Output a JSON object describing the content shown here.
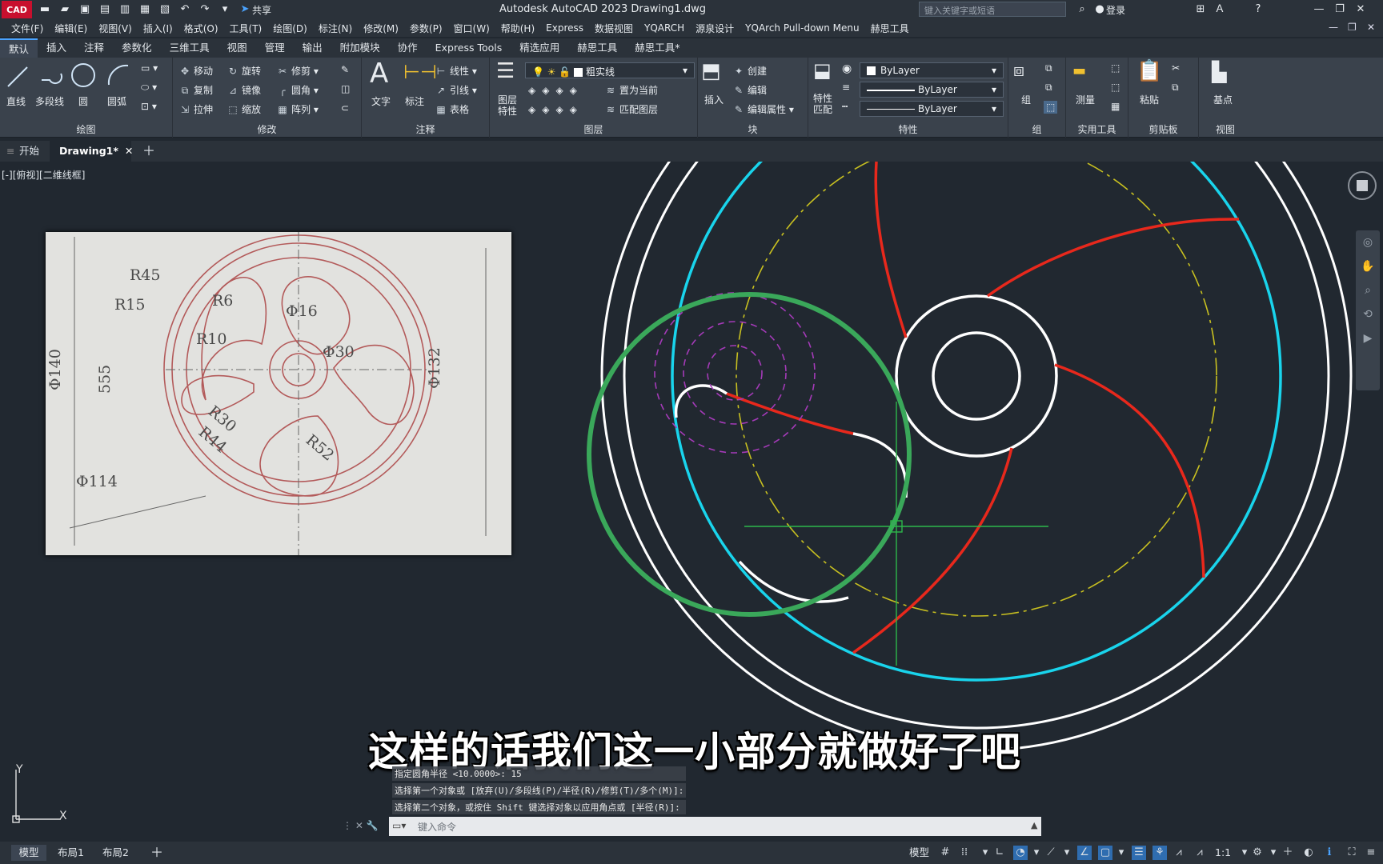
{
  "titlebar": {
    "logo_text": "CAD",
    "share_label": "共享",
    "title": "Autodesk AutoCAD 2023    Drawing1.dwg",
    "search_placeholder": "键入关键字或短语",
    "login_label": "登录"
  },
  "menubar": {
    "items": [
      "文件(F)",
      "编辑(E)",
      "视图(V)",
      "插入(I)",
      "格式(O)",
      "工具(T)",
      "绘图(D)",
      "标注(N)",
      "修改(M)",
      "参数(P)",
      "窗口(W)",
      "帮助(H)",
      "Express",
      "数据视图",
      "YQARCH",
      "源泉设计",
      "YQArch Pull-down Menu",
      "赫思工具"
    ]
  },
  "ribbon_tabs": [
    "默认",
    "插入",
    "注释",
    "参数化",
    "三维工具",
    "视图",
    "管理",
    "输出",
    "附加模块",
    "协作",
    "Express Tools",
    "精选应用",
    "赫思工具",
    "赫思工具*"
  ],
  "ribbon": {
    "draw": {
      "title": "绘图",
      "line": "直线",
      "polyline": "多段线",
      "circle": "圆",
      "arc": "圆弧"
    },
    "modify": {
      "title": "修改",
      "move": "移动",
      "rotate": "旋转",
      "trim": "修剪",
      "copy": "复制",
      "mirror": "镜像",
      "fillet": "圆角",
      "stretch": "拉伸",
      "scale": "缩放",
      "array": "阵列"
    },
    "annotation": {
      "title": "注释",
      "text": "文字",
      "dimension": "标注",
      "linear": "线性",
      "leader": "引线",
      "table": "表格"
    },
    "layers": {
      "title": "图层",
      "layer_props": "图层特性",
      "current_layer": "粗实线",
      "make_current": "置为当前",
      "match_layer": "匹配图层"
    },
    "block": {
      "title": "块",
      "insert": "插入",
      "create": "创建",
      "edit": "编辑",
      "edit_attr": "编辑属性"
    },
    "properties": {
      "title": "特性",
      "match": "特性匹配",
      "color": "ByLayer",
      "linetype": "ByLayer",
      "lineweight": "ByLayer"
    },
    "groups": {
      "title": "组",
      "group": "组"
    },
    "utilities": {
      "title": "实用工具",
      "measure": "测量"
    },
    "clipboard": {
      "title": "剪贴板",
      "paste": "粘贴"
    },
    "view": {
      "title": "视图",
      "base": "基点"
    }
  },
  "doc_tabs": {
    "start": "开始",
    "drawing": "Drawing1*"
  },
  "viewport": {
    "label": "[-][俯视][二维线框]",
    "ref_dims": [
      "R45",
      "R15",
      "R6",
      "Φ16",
      "R10",
      "Φ30",
      "Φ140",
      "Φ132",
      "555",
      "R30",
      "R44",
      "R52",
      "Φ114"
    ],
    "ucs_y": "Y",
    "ucs_x": "X"
  },
  "subtitle": "这样的话我们这一小部分就做好了吧",
  "command": {
    "history": [
      "指定圆角半径 <10.0000>: 15",
      "选择第一个对象或 [放弃(U)/多段线(P)/半径(R)/修剪(T)/多个(M)]:",
      "选择第二个对象，或按住 Shift 键选择对象以应用角点或 [半径(R)]:"
    ],
    "placeholder": "键入命令"
  },
  "statusbar": {
    "layouts": [
      "模型",
      "布局1",
      "布局2"
    ],
    "model_label": "模型",
    "scale": "1:1"
  },
  "colors": {
    "background": "#212830",
    "white_geom": "#ffffff",
    "cyan_circle": "#19d4ec",
    "red_blade": "#e8281c",
    "yellow_dash": "#c8c020",
    "green_circle": "#3aa85a",
    "magenta_dash": "#a43ab8"
  }
}
